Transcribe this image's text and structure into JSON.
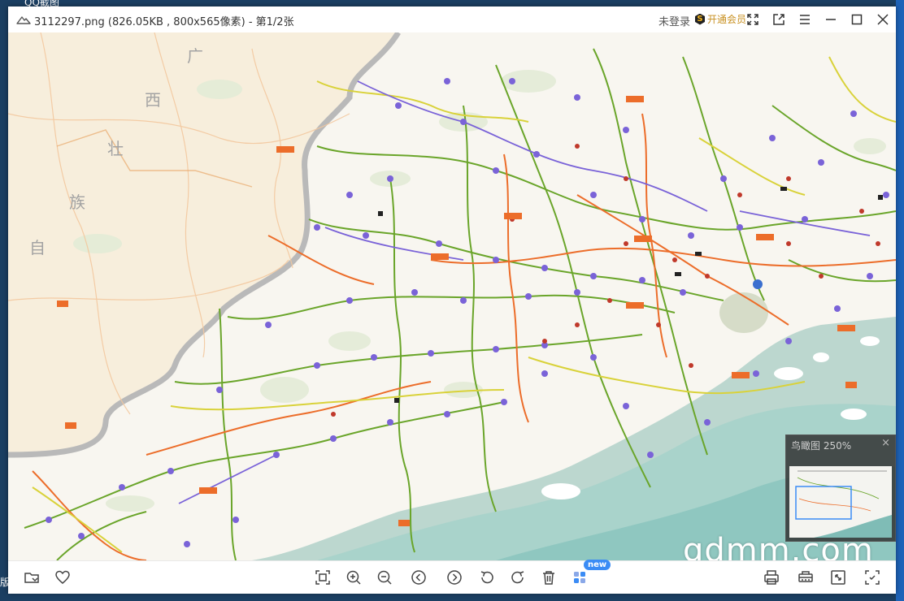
{
  "desktop": {
    "top_text": "QQ截图",
    "left_text": "版"
  },
  "window": {
    "title": "3112297.png (826.05KB , 800x565像素) - 第1/2张",
    "login_label": "未登录",
    "vip_badge": "S",
    "vip_label": "开通会员"
  },
  "map": {
    "labels": [
      "广",
      "西",
      "壮",
      "族",
      "自"
    ],
    "colors": {
      "land": "#f8f6f0",
      "sea": "#a9d3cb",
      "expressway_orange": "#ec6d2a",
      "expressway_green": "#6aa52a",
      "expressway_yellow": "#d9d23a",
      "toll_purple": "#7a63d8",
      "boundary": "#b9b9b9"
    }
  },
  "birdseye": {
    "title": "鸟瞰图 250%",
    "close": "×"
  },
  "toolbar": {
    "new_badge": "new"
  },
  "watermark": "gdmm.com",
  "icons": {
    "app": "cloud-icon",
    "folder": "folder-icon",
    "favorite": "heart-icon",
    "fit": "fit-screen-icon",
    "zoom_in": "zoom-in-icon",
    "zoom_out": "zoom-out-icon",
    "prev": "previous-icon",
    "next": "next-icon",
    "rotate_left": "rotate-left-icon",
    "rotate_right": "rotate-right-icon",
    "delete": "trash-icon",
    "apps": "apps-icon",
    "print": "print-icon",
    "scan": "scanner-icon",
    "fullscreen": "fullscreen-icon",
    "crop": "screenshot-icon"
  }
}
